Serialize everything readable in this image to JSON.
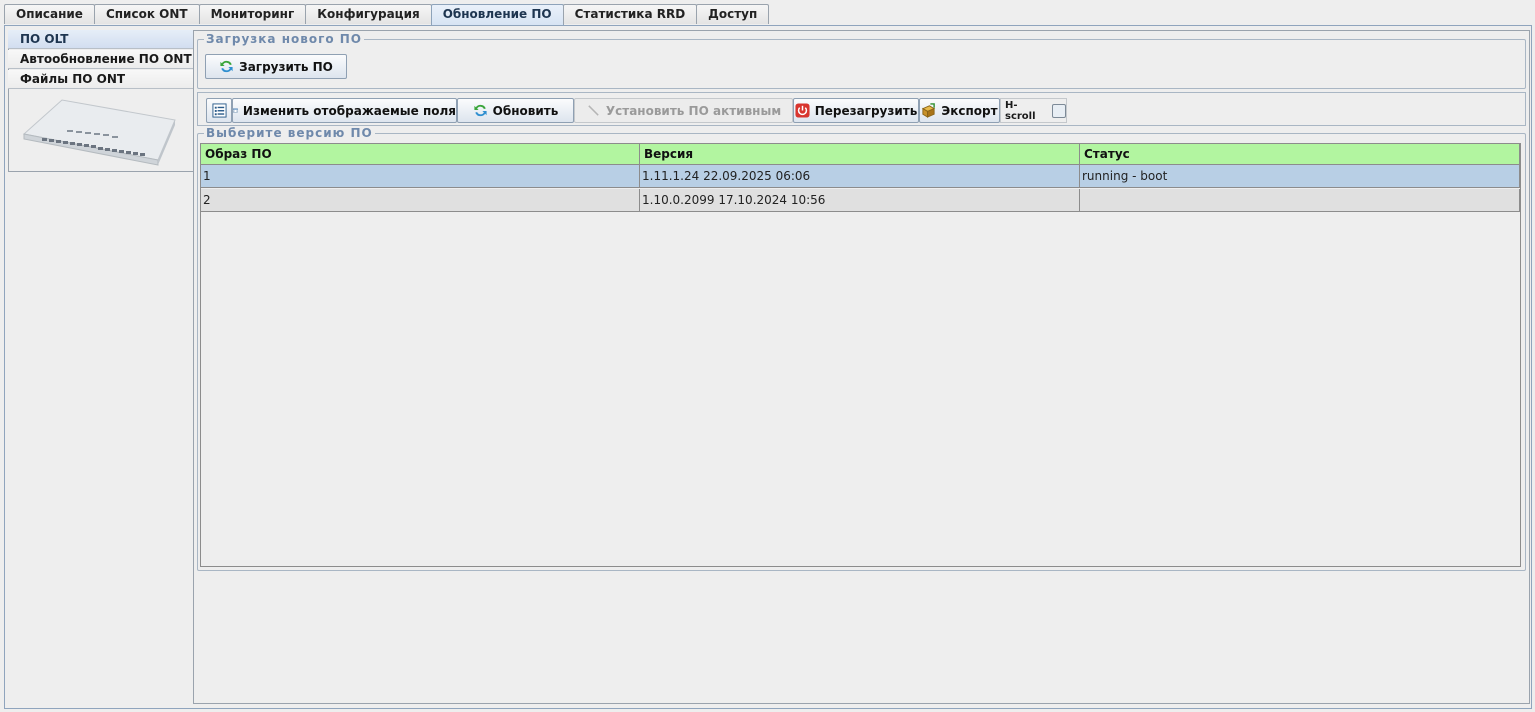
{
  "top_tabs": [
    {
      "label": "Описание"
    },
    {
      "label": "Список ONT"
    },
    {
      "label": "Мониторинг"
    },
    {
      "label": "Конфигурация"
    },
    {
      "label": "Обновление ПО",
      "active": true
    },
    {
      "label": "Статистика RRD"
    },
    {
      "label": "Доступ"
    }
  ],
  "side_tabs": [
    {
      "label": "ПО OLT",
      "active": true
    },
    {
      "label": "Автообновление ПО ONT"
    },
    {
      "label": "Файлы ПО ONT"
    }
  ],
  "upload_section": {
    "legend": "Загрузка нового ПО",
    "upload_button": "Загрузить ПО"
  },
  "toolbar": {
    "fields_button": "Изменить отображаемые поля",
    "refresh_button": "Обновить",
    "set_active_button": "Установить ПО активным",
    "reboot_button": "Перезагрузить",
    "export_button": "Экспорт",
    "hscroll_label": "H-scroll",
    "hscroll_checked": false
  },
  "versions_section": {
    "legend": "Выберите версию ПО",
    "columns": [
      "Образ ПО",
      "Версия",
      "Статус"
    ],
    "rows": [
      {
        "image": "1",
        "version": "1.11.1.24 22.09.2025 06:06",
        "status": "running - boot",
        "selected": true
      },
      {
        "image": "2",
        "version": "1.10.0.2099 17.10.2024 10:56",
        "status": "",
        "selected": false
      }
    ]
  },
  "colors": {
    "header_bg": "#b2f5a0",
    "selected_row": "#b8cfe5",
    "legend_text": "#6f89ab"
  }
}
